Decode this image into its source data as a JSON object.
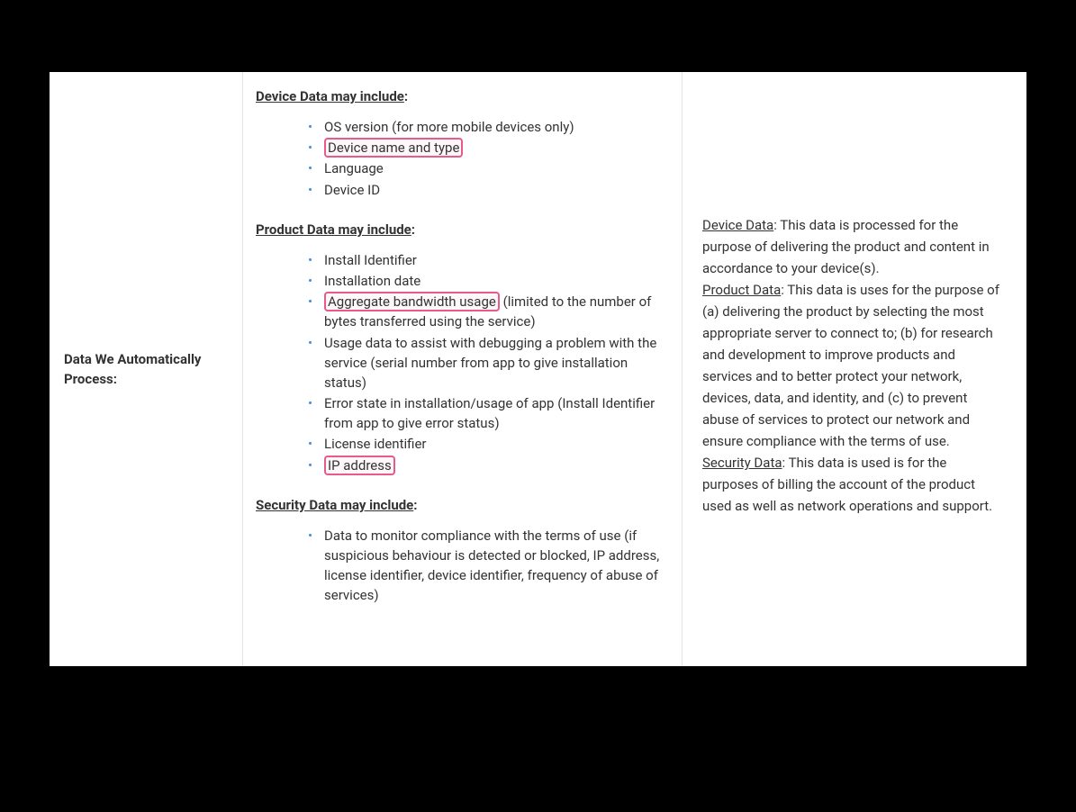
{
  "left": {
    "heading": "Data We Automatically Process:"
  },
  "middle": {
    "device_heading": "Device Data may include",
    "device_items": {
      "i0": "OS version (for more mobile devices only)",
      "i1": "Device name and type",
      "i2": "Language",
      "i3": "Device ID"
    },
    "product_heading": "Product Data may include",
    "product_items": {
      "i0": "Install Identifier",
      "i1": "Installation date",
      "i2_highlight": "Aggregate bandwidth usage",
      "i2_rest": " (limited to the number of bytes transferred using the service)",
      "i3": "Usage data to assist with debugging a problem with the service (serial number from app to give installation status)",
      "i4": "Error state in installation/usage of app (Install Identifier from app to give error status)",
      "i5": "License identifier",
      "i6": "IP address"
    },
    "security_heading": "Security Data may include",
    "security_items": {
      "i0": "Data to monitor compliance with the terms of use (if suspicious behaviour is detected or blocked, IP address, license identifier, device identifier, frequency of abuse of services)"
    },
    "colon": ":"
  },
  "right": {
    "device_head": "Device Data",
    "device_body": ": This data is processed for the purpose of delivering the product and content in accordance to your device(s).",
    "product_head": "Product Data",
    "product_body": ": This data is uses for the purpose of (a) delivering the product by selecting the most appropriate server to connect to; (b) for research and development to improve products and services and to better protect your network, devices, data, and identity, and (c) to prevent abuse of services to protect our network and ensure compliance with the terms of use.",
    "security_head": "Security Data",
    "security_body": ": This data is used is for the purposes of billing the account of the product used as well as network operations and support."
  }
}
